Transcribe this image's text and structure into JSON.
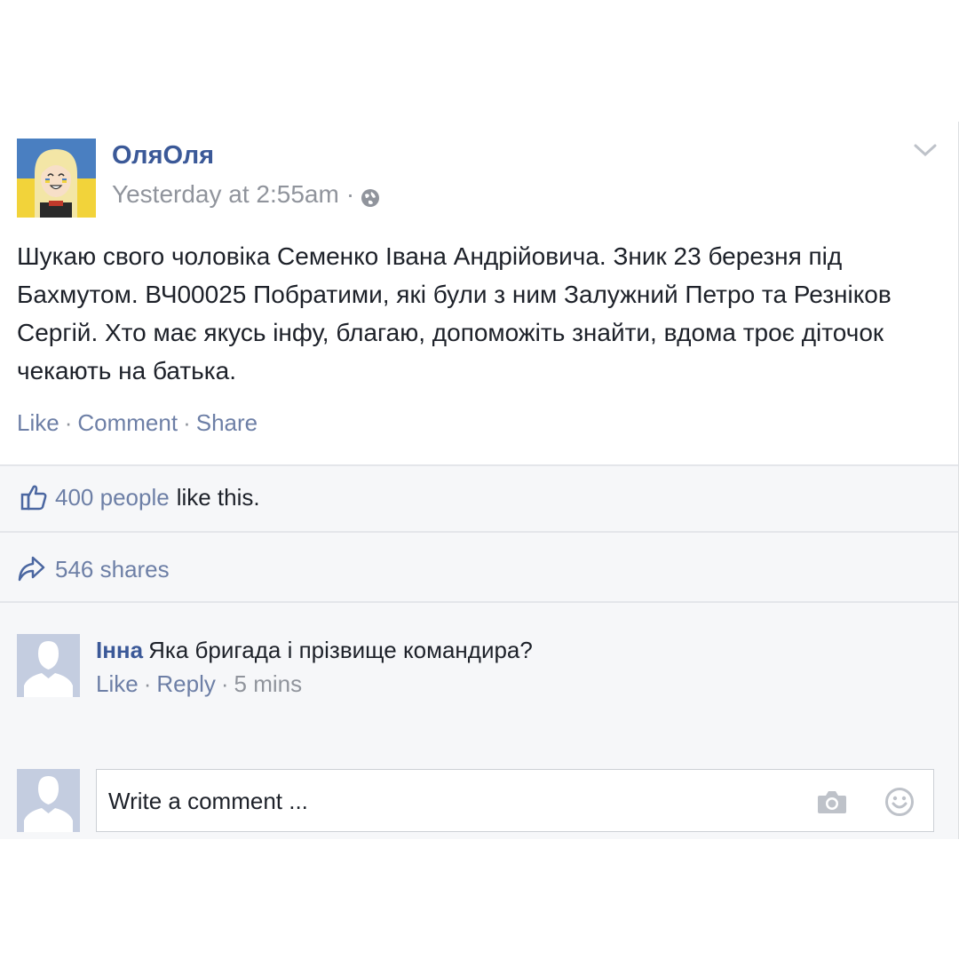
{
  "post": {
    "author": "ОляОля",
    "timestamp": "Yesterday at 2:55am",
    "meta_separator": "·",
    "privacy_icon": "globe-icon",
    "menu_icon": "chevron-down-icon",
    "text": "Шукаю свого чоловіка Семенко Івана Андрійовича. Зник 23 березня під Бахмутом. ВЧ00025 Побратими, які були з ним Залужний Петро та Резніков Сергій. Хто має якусь інфу, благаю, допоможіть знайти, вдома троє діточок чекають на батька.",
    "actions": {
      "like": "Like",
      "comment": "Comment",
      "share": "Share",
      "separator": "·"
    }
  },
  "likes": {
    "count_link": "400 people",
    "suffix": "like this.",
    "icon": "thumbs-up-icon"
  },
  "shares": {
    "label": "546 shares",
    "icon": "share-arrow-icon"
  },
  "comments": [
    {
      "author": "Інна",
      "text": "Яка бригада і прізвище командира?",
      "like": "Like",
      "reply": "Reply",
      "time": "5 mins",
      "separator": "·"
    }
  ],
  "composer": {
    "placeholder": "Write a comment ...",
    "camera_icon": "camera-icon",
    "emoji_icon": "smiley-icon"
  },
  "colors": {
    "link": "#3b5998",
    "muted_link": "#6d7fa6",
    "gray_text": "#90949c",
    "body_text": "#1d2129",
    "flag_blue": "#4a7fc1",
    "flag_yellow": "#f2d33a"
  }
}
